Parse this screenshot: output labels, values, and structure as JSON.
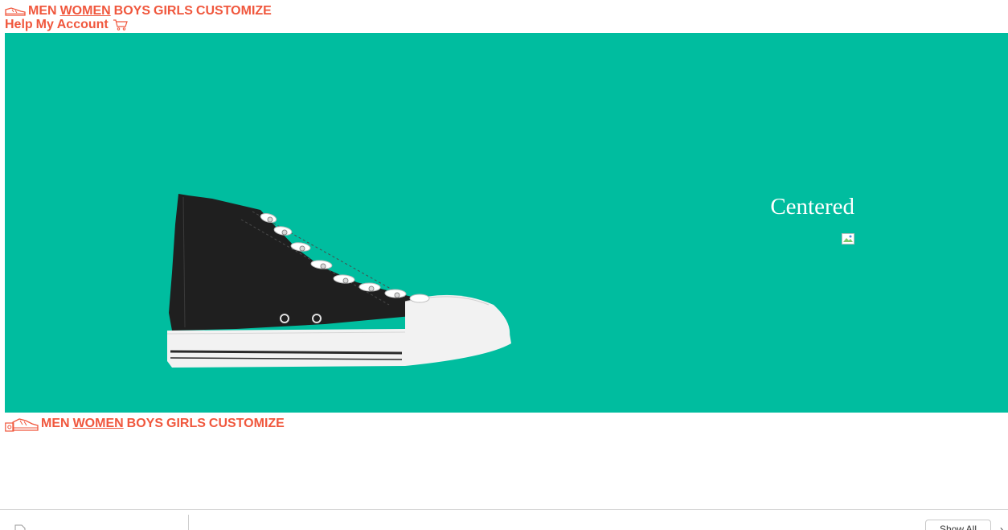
{
  "colors": {
    "accent": "#f0573d",
    "hero_bg": "#00bd9f",
    "shoe_body": "#1f1f1f",
    "shoe_sole": "#f2f2f2"
  },
  "nav": {
    "logo_icon": "sneaker-logo-icon",
    "items": [
      {
        "label": "MEN"
      },
      {
        "label": "WOMEN"
      },
      {
        "label": "BOYS"
      },
      {
        "label": "GIRLS"
      },
      {
        "label": "CUSTOMIZE"
      }
    ]
  },
  "utility": {
    "help_label": "Help",
    "account_label": "My Account",
    "cart_icon": "cart-icon"
  },
  "hero": {
    "title": "Centered",
    "image_icon": "broken-image-icon",
    "product_icon": "high-top-sneaker"
  },
  "footer_nav": {
    "items": [
      {
        "label": "MEN"
      },
      {
        "label": "WOMEN"
      },
      {
        "label": "BOYS"
      },
      {
        "label": "GIRLS"
      },
      {
        "label": "CUSTOMIZE"
      }
    ]
  },
  "download_bar": {
    "file_label": "",
    "show_all_label": "Show All",
    "chevron": "›"
  }
}
